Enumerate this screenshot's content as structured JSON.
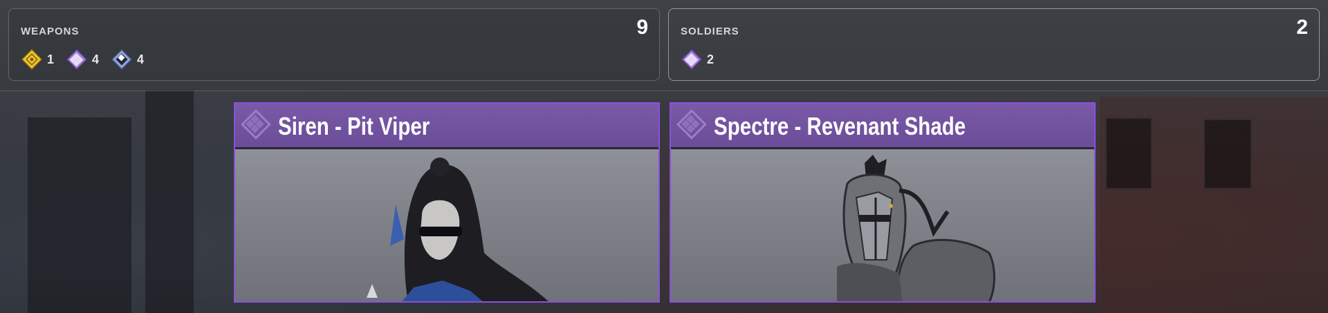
{
  "panels": {
    "weapons": {
      "title": "WEAPONS",
      "total": "9",
      "rarities": [
        {
          "icon": "legendary-gold-diamond-icon",
          "color": "#f2c531",
          "count": "1"
        },
        {
          "icon": "epic-purple-diamond-icon",
          "color": "#a07ad6",
          "count": "4"
        },
        {
          "icon": "rare-blue-diamond-icon",
          "color": "#8fa2d4",
          "count": "4"
        }
      ]
    },
    "soldiers": {
      "title": "SOLDIERS",
      "total": "2",
      "rarities": [
        {
          "icon": "epic-purple-diamond-icon",
          "color": "#a07ad6",
          "count": "2"
        }
      ]
    }
  },
  "cards": [
    {
      "title": "Siren - Pit Viper",
      "rarity_icon": "epic-diamond-watermark-icon",
      "accent": "#8b4fe0"
    },
    {
      "title": "Spectre - Revenant Shade",
      "rarity_icon": "epic-diamond-watermark-icon",
      "accent": "#8b4fe0"
    }
  ]
}
